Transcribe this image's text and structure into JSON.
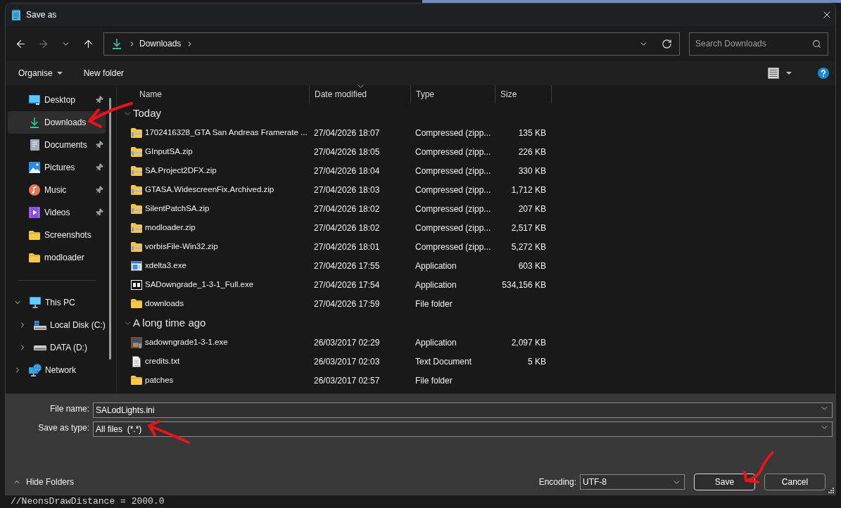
{
  "window": {
    "title": "Save as"
  },
  "nav_buttons": [
    {
      "kind": "back",
      "disabled": false
    },
    {
      "kind": "forward",
      "disabled": true
    },
    {
      "kind": "recent",
      "disabled": false
    },
    {
      "kind": "up",
      "disabled": false
    }
  ],
  "address_bar": {
    "crumbs": [
      "Downloads"
    ]
  },
  "search": {
    "placeholder": "Search Downloads"
  },
  "command_bar": {
    "buttons": [
      {
        "label": "Organise",
        "menu": true
      },
      {
        "label": "New folder",
        "menu": false
      }
    ]
  },
  "sidebar": {
    "quick_access": [
      {
        "label": "Desktop",
        "kind": "desktop",
        "pinned": true,
        "selected": false
      },
      {
        "label": "Downloads",
        "kind": "downloads",
        "pinned": false,
        "selected": true
      },
      {
        "label": "Documents",
        "kind": "documents",
        "pinned": true,
        "selected": false
      },
      {
        "label": "Pictures",
        "kind": "pictures",
        "pinned": true,
        "selected": false
      },
      {
        "label": "Music",
        "kind": "music",
        "pinned": true,
        "selected": false
      },
      {
        "label": "Videos",
        "kind": "videos",
        "pinned": true,
        "selected": false
      },
      {
        "label": "Screenshots",
        "kind": "folder",
        "pinned": false,
        "selected": false
      },
      {
        "label": "modloader",
        "kind": "folder",
        "pinned": false,
        "selected": false
      }
    ],
    "tree": [
      {
        "label": "This PC",
        "kind": "pc",
        "expanded": true,
        "selected": false,
        "children": [
          {
            "label": "Local Disk (C:)",
            "kind": "disk",
            "expanded": false,
            "selected": false
          },
          {
            "label": "DATA (D:)",
            "kind": "drive",
            "expanded": false,
            "selected": false
          }
        ]
      },
      {
        "label": "Network",
        "kind": "network",
        "expanded": false,
        "selected": false
      }
    ]
  },
  "file_list": {
    "columns": [
      {
        "label": "Name",
        "sorted": false
      },
      {
        "label": "Date modified",
        "sorted": true
      },
      {
        "label": "Type",
        "sorted": false
      },
      {
        "label": "Size",
        "sorted": false
      }
    ],
    "groups": [
      {
        "label": "Today",
        "expanded": true,
        "rows": [
          {
            "name": "1702416328_GTA San Andreas Framerate ...",
            "kind": "zip",
            "date": "27/04/2026 18:07",
            "type": "Compressed (zipp...",
            "size": "135 KB",
            "selected": false
          },
          {
            "name": "GInputSA.zip",
            "kind": "zip",
            "date": "27/04/2026 18:05",
            "type": "Compressed (zipp...",
            "size": "226 KB",
            "selected": false
          },
          {
            "name": "SA.Project2DFX.zip",
            "kind": "zip",
            "date": "27/04/2026 18:04",
            "type": "Compressed (zipp...",
            "size": "330 KB",
            "selected": false
          },
          {
            "name": "GTASA.WidescreenFix.Archived.zip",
            "kind": "zip",
            "date": "27/04/2026 18:03",
            "type": "Compressed (zipp...",
            "size": "1,712 KB",
            "selected": false
          },
          {
            "name": "SilentPatchSA.zip",
            "kind": "zip",
            "date": "27/04/2026 18:02",
            "type": "Compressed (zipp...",
            "size": "207 KB",
            "selected": false
          },
          {
            "name": "modloader.zip",
            "kind": "zip",
            "date": "27/04/2026 18:02",
            "type": "Compressed (zipp...",
            "size": "2,517 KB",
            "selected": false
          },
          {
            "name": "vorbisFile-Win32.zip",
            "kind": "zip",
            "date": "27/04/2026 18:01",
            "type": "Compressed (zipp...",
            "size": "5,272 KB",
            "selected": false
          },
          {
            "name": "xdelta3.exe",
            "kind": "exe",
            "date": "27/04/2026 17:55",
            "type": "Application",
            "size": "603 KB",
            "selected": false
          },
          {
            "name": "SADowngrade_1-3-1_Full.exe",
            "kind": "sevenzip",
            "date": "27/04/2026 17:54",
            "type": "Application",
            "size": "534,156 KB",
            "selected": false
          },
          {
            "name": "downloads",
            "kind": "folder",
            "date": "27/04/2026 17:59",
            "type": "File folder",
            "selected": false
          }
        ]
      },
      {
        "label": "A long time ago",
        "expanded": true,
        "rows": [
          {
            "name": "sadowngrade1-3-1.exe",
            "kind": "appimage",
            "date": "26/03/2017 02:29",
            "type": "Application",
            "size": "2,097 KB",
            "selected": false
          },
          {
            "name": "credits.txt",
            "kind": "text",
            "date": "26/03/2017 02:03",
            "type": "Text Document",
            "size": "5 KB",
            "selected": false
          },
          {
            "name": "patches",
            "kind": "folder",
            "date": "26/03/2017 02:57",
            "type": "File folder",
            "selected": false
          }
        ]
      }
    ]
  },
  "save_form": {
    "fields": [
      {
        "label": "File name:",
        "value": "SALodLights.ini"
      },
      {
        "label": "Save as type:",
        "value": "All files  (*.*)"
      }
    ]
  },
  "footer": {
    "hide_folders": "Hide Folders",
    "encoding": {
      "label": "Encoding:",
      "value": "UTF-8"
    },
    "buttons": [
      {
        "label": "Save",
        "default": true
      },
      {
        "label": "Cancel",
        "default": false
      }
    ]
  },
  "background": {
    "code_line": "//NeonsDrawDistance = 2000.0"
  }
}
